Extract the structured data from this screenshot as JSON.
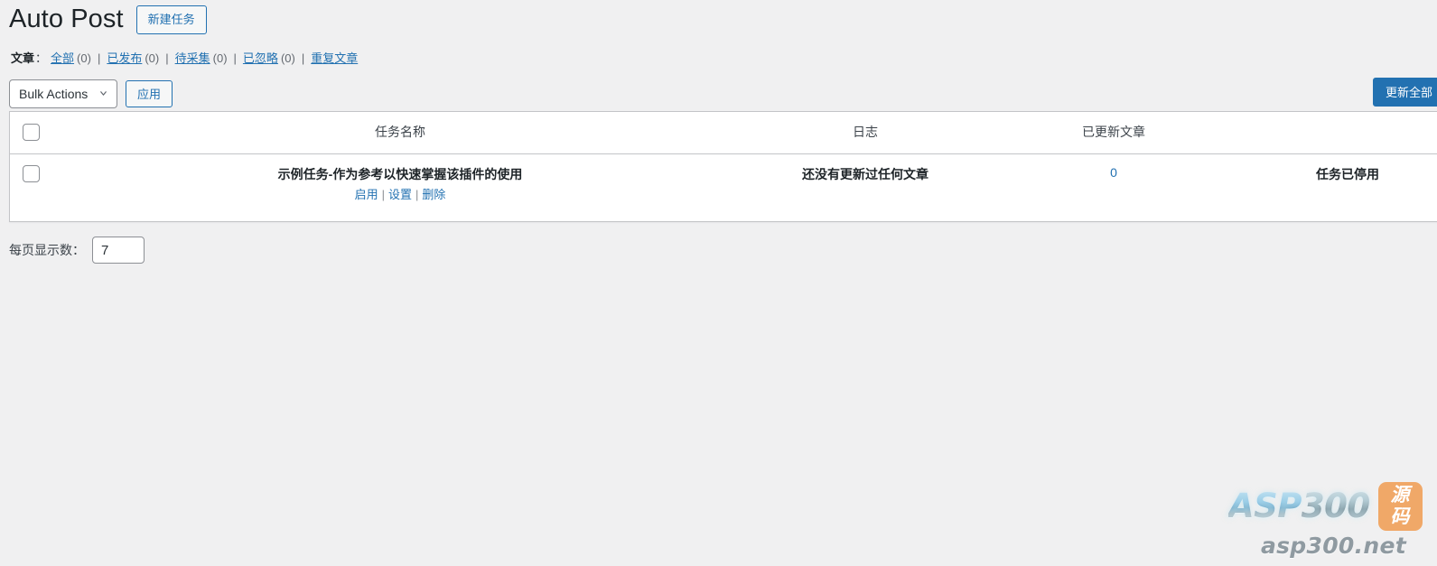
{
  "header": {
    "title": "Auto Post",
    "new_task_button": "新建任务"
  },
  "filters": {
    "group_label": "文章",
    "colon": "：",
    "items": [
      {
        "label": "全部",
        "count": "(0)",
        "has_count": true
      },
      {
        "label": "已发布",
        "count": "(0)",
        "has_count": true
      },
      {
        "label": "待采集",
        "count": "(0)",
        "has_count": true
      },
      {
        "label": "已忽略",
        "count": "(0)",
        "has_count": true
      },
      {
        "label": "重复文章",
        "count": "",
        "has_count": false
      }
    ],
    "separator": "|"
  },
  "tablenav": {
    "bulk_actions_selected": "Bulk Actions",
    "bulk_actions_options": [
      "Bulk Actions"
    ],
    "apply_button": "应用",
    "update_all_button": "更新全部"
  },
  "table": {
    "columns": [
      {
        "key": "cb",
        "label": ""
      },
      {
        "key": "name",
        "label": "任务名称"
      },
      {
        "key": "log",
        "label": "日志"
      },
      {
        "key": "count",
        "label": "已更新文章"
      },
      {
        "key": "status",
        "label": ""
      }
    ],
    "rows": [
      {
        "name": "示例任务-作为参考以快速掌握该插件的使用",
        "actions": [
          "启用",
          "设置",
          "删除"
        ],
        "action_separator": "|",
        "log": "还没有更新过任何文章",
        "count": "0",
        "status": "任务已停用"
      }
    ]
  },
  "per_page": {
    "label": "每页显示数：",
    "value": "7"
  },
  "watermark": {
    "brand_light": "ASP",
    "brand_dark": "300",
    "badge": "源码",
    "url": "asp300.net"
  },
  "colors": {
    "accent_blue": "#2271b1",
    "page_bg": "#f0f0f1",
    "badge_orange": "#f0a868",
    "text_dark": "#1d2327"
  }
}
